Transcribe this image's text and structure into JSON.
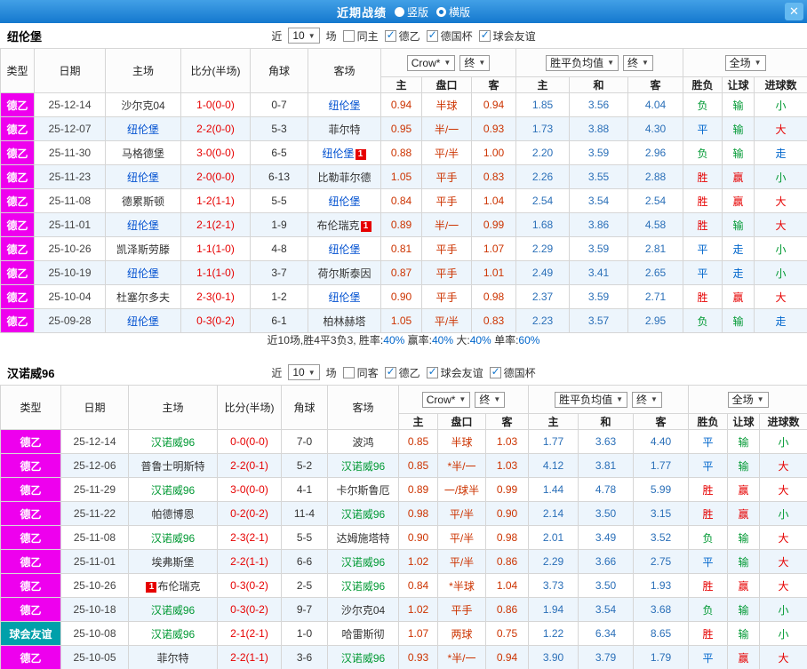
{
  "colors": {
    "topbar_from": "#42a0e6",
    "topbar_to": "#1478ce",
    "league_de2": "#ee00ee",
    "league_friendly": "#00a0aa",
    "score": "#e60000",
    "odds": "#cc3300",
    "avg": "#2a6fb8",
    "win": "#e60000",
    "draw": "#0066cc",
    "lose": "#009933",
    "focus_team_1": "#0050d0",
    "focus_team_2": "#009933",
    "badge": "#e60000",
    "row_alt": "#edf5fc"
  },
  "topbar": {
    "title": "近期战绩",
    "close": "✕",
    "radios": [
      {
        "label": "竖版",
        "checked": false
      },
      {
        "label": "横版",
        "checked": true
      }
    ]
  },
  "result_color_map": {
    "胜": "win",
    "平": "draw",
    "负": "lose",
    "赢": "win",
    "输": "lose",
    "走": "draw",
    "大": "win",
    "小": "lose"
  },
  "sections": [
    {
      "team": "纽伦堡",
      "team_color_key": "focus_team_1",
      "filter": {
        "near": "近",
        "count": "10",
        "unit": "场",
        "checkboxes": [
          {
            "label": "同主",
            "checked": false
          },
          {
            "label": "德乙",
            "checked": true
          },
          {
            "label": "德国杯",
            "checked": true
          },
          {
            "label": "球会友谊",
            "checked": true
          }
        ]
      },
      "columns": {
        "type": "类型",
        "date": "日期",
        "home": "主场",
        "score": "比分(半场)",
        "corner": "角球",
        "away": "客场",
        "odds_source": "Crow*",
        "odds_final": "终",
        "avg_source": "胜平负均值",
        "avg_final": "终",
        "scope": "全场",
        "sub": [
          "主",
          "盘口",
          "客",
          "主",
          "和",
          "客",
          "胜负",
          "让球",
          "进球数"
        ]
      },
      "rows": [
        {
          "league": "德乙",
          "date": "25-12-14",
          "home": "沙尔克04",
          "home_focus": false,
          "away": "纽伦堡",
          "away_focus": true,
          "score": "1-0(0-0)",
          "corner": "0-7",
          "odds": [
            "0.94",
            "半球",
            "0.94"
          ],
          "avg": [
            "1.85",
            "3.56",
            "4.04"
          ],
          "result": "负",
          "handicap": "输",
          "goals": "小"
        },
        {
          "league": "德乙",
          "date": "25-12-07",
          "home": "纽伦堡",
          "home_focus": true,
          "away": "菲尔特",
          "away_focus": false,
          "score": "2-2(0-0)",
          "corner": "5-3",
          "odds": [
            "0.95",
            "半/一",
            "0.93"
          ],
          "avg": [
            "1.73",
            "3.88",
            "4.30"
          ],
          "result": "平",
          "handicap": "输",
          "goals": "大"
        },
        {
          "league": "德乙",
          "date": "25-11-30",
          "home": "马格德堡",
          "home_focus": false,
          "away": "纽伦堡",
          "away_focus": true,
          "away_badge": "1",
          "score": "3-0(0-0)",
          "corner": "6-5",
          "odds": [
            "0.88",
            "平/半",
            "1.00"
          ],
          "avg": [
            "2.20",
            "3.59",
            "2.96"
          ],
          "result": "负",
          "handicap": "输",
          "goals": "走"
        },
        {
          "league": "德乙",
          "date": "25-11-23",
          "home": "纽伦堡",
          "home_focus": true,
          "away": "比勒菲尔德",
          "away_focus": false,
          "score": "2-0(0-0)",
          "corner": "6-13",
          "odds": [
            "1.05",
            "平手",
            "0.83"
          ],
          "avg": [
            "2.26",
            "3.55",
            "2.88"
          ],
          "result": "胜",
          "handicap": "赢",
          "goals": "小"
        },
        {
          "league": "德乙",
          "date": "25-11-08",
          "home": "德累斯顿",
          "home_focus": false,
          "away": "纽伦堡",
          "away_focus": true,
          "score": "1-2(1-1)",
          "corner": "5-5",
          "odds": [
            "0.84",
            "平手",
            "1.04"
          ],
          "avg": [
            "2.54",
            "3.54",
            "2.54"
          ],
          "result": "胜",
          "handicap": "赢",
          "goals": "大"
        },
        {
          "league": "德乙",
          "date": "25-11-01",
          "home": "纽伦堡",
          "home_focus": true,
          "away": "布伦瑞克",
          "away_focus": false,
          "away_badge": "1",
          "score": "2-1(2-1)",
          "corner": "1-9",
          "odds": [
            "0.89",
            "半/一",
            "0.99"
          ],
          "avg": [
            "1.68",
            "3.86",
            "4.58"
          ],
          "result": "胜",
          "handicap": "输",
          "goals": "大"
        },
        {
          "league": "德乙",
          "date": "25-10-26",
          "home": "凯泽斯劳滕",
          "home_focus": false,
          "away": "纽伦堡",
          "away_focus": true,
          "score": "1-1(1-0)",
          "corner": "4-8",
          "odds": [
            "0.81",
            "平手",
            "1.07"
          ],
          "avg": [
            "2.29",
            "3.59",
            "2.81"
          ],
          "result": "平",
          "handicap": "走",
          "goals": "小"
        },
        {
          "league": "德乙",
          "date": "25-10-19",
          "home": "纽伦堡",
          "home_focus": true,
          "away": "荷尔斯泰因",
          "away_focus": false,
          "score": "1-1(1-0)",
          "corner": "3-7",
          "odds": [
            "0.87",
            "平手",
            "1.01"
          ],
          "avg": [
            "2.49",
            "3.41",
            "2.65"
          ],
          "result": "平",
          "handicap": "走",
          "goals": "小"
        },
        {
          "league": "德乙",
          "date": "25-10-04",
          "home": "杜塞尔多夫",
          "home_focus": false,
          "away": "纽伦堡",
          "away_focus": true,
          "score": "2-3(0-1)",
          "corner": "1-2",
          "odds": [
            "0.90",
            "平手",
            "0.98"
          ],
          "avg": [
            "2.37",
            "3.59",
            "2.71"
          ],
          "result": "胜",
          "handicap": "赢",
          "goals": "大"
        },
        {
          "league": "德乙",
          "date": "25-09-28",
          "home": "纽伦堡",
          "home_focus": true,
          "away": "柏林赫塔",
          "away_focus": false,
          "score": "0-3(0-2)",
          "corner": "6-1",
          "odds": [
            "1.05",
            "平/半",
            "0.83"
          ],
          "avg": [
            "2.23",
            "3.57",
            "2.95"
          ],
          "result": "负",
          "handicap": "输",
          "goals": "走"
        }
      ],
      "summary": {
        "prefix": "近10场,胜4平3负3,",
        "stats": [
          {
            "label": "胜率:",
            "value": "40%"
          },
          {
            "label": "赢率:",
            "value": "40%"
          },
          {
            "label": "大:",
            "value": "40%"
          },
          {
            "label": "单率:",
            "value": "60%"
          }
        ]
      }
    },
    {
      "team": "汉诺威96",
      "team_color_key": "focus_team_2",
      "filter": {
        "near": "近",
        "count": "10",
        "unit": "场",
        "checkboxes": [
          {
            "label": "同客",
            "checked": false
          },
          {
            "label": "德乙",
            "checked": true
          },
          {
            "label": "球会友谊",
            "checked": true
          },
          {
            "label": "德国杯",
            "checked": true
          }
        ]
      },
      "columns": {
        "type": "类型",
        "date": "日期",
        "home": "主场",
        "score": "比分(半场)",
        "corner": "角球",
        "away": "客场",
        "odds_source": "Crow*",
        "odds_final": "终",
        "avg_source": "胜平负均值",
        "avg_final": "终",
        "scope": "全场",
        "sub": [
          "主",
          "盘口",
          "客",
          "主",
          "和",
          "客",
          "胜负",
          "让球",
          "进球数"
        ]
      },
      "rows": [
        {
          "league": "德乙",
          "date": "25-12-14",
          "home": "汉诺威96",
          "home_focus": true,
          "away": "波鸿",
          "away_focus": false,
          "score": "0-0(0-0)",
          "corner": "7-0",
          "odds": [
            "0.85",
            "半球",
            "1.03"
          ],
          "avg": [
            "1.77",
            "3.63",
            "4.40"
          ],
          "result": "平",
          "handicap": "输",
          "goals": "小"
        },
        {
          "league": "德乙",
          "date": "25-12-06",
          "home": "普鲁士明斯特",
          "home_focus": false,
          "away": "汉诺威96",
          "away_focus": true,
          "score": "2-2(0-1)",
          "corner": "5-2",
          "odds": [
            "0.85",
            "*半/一",
            "1.03"
          ],
          "avg": [
            "4.12",
            "3.81",
            "1.77"
          ],
          "result": "平",
          "handicap": "输",
          "goals": "大"
        },
        {
          "league": "德乙",
          "date": "25-11-29",
          "home": "汉诺威96",
          "home_focus": true,
          "away": "卡尔斯鲁厄",
          "away_focus": false,
          "score": "3-0(0-0)",
          "corner": "4-1",
          "odds": [
            "0.89",
            "一/球半",
            "0.99"
          ],
          "avg": [
            "1.44",
            "4.78",
            "5.99"
          ],
          "result": "胜",
          "handicap": "赢",
          "goals": "大"
        },
        {
          "league": "德乙",
          "date": "25-11-22",
          "home": "帕德博恩",
          "home_focus": false,
          "away": "汉诺威96",
          "away_focus": true,
          "score": "0-2(0-2)",
          "corner": "11-4",
          "odds": [
            "0.98",
            "平/半",
            "0.90"
          ],
          "avg": [
            "2.14",
            "3.50",
            "3.15"
          ],
          "result": "胜",
          "handicap": "赢",
          "goals": "小"
        },
        {
          "league": "德乙",
          "date": "25-11-08",
          "home": "汉诺威96",
          "home_focus": true,
          "away": "达姆施塔特",
          "away_focus": false,
          "score": "2-3(2-1)",
          "corner": "5-5",
          "odds": [
            "0.90",
            "平/半",
            "0.98"
          ],
          "avg": [
            "2.01",
            "3.49",
            "3.52"
          ],
          "result": "负",
          "handicap": "输",
          "goals": "大"
        },
        {
          "league": "德乙",
          "date": "25-11-01",
          "home": "埃弗斯堡",
          "home_focus": false,
          "away": "汉诺威96",
          "away_focus": true,
          "score": "2-2(1-1)",
          "corner": "6-6",
          "odds": [
            "1.02",
            "平/半",
            "0.86"
          ],
          "avg": [
            "2.29",
            "3.66",
            "2.75"
          ],
          "result": "平",
          "handicap": "输",
          "goals": "大"
        },
        {
          "league": "德乙",
          "date": "25-10-26",
          "home": "布伦瑞克",
          "home_focus": false,
          "home_badge": "1",
          "home_badge_side": "left",
          "away": "汉诺威96",
          "away_focus": true,
          "score": "0-3(0-2)",
          "corner": "2-5",
          "odds": [
            "0.84",
            "*半球",
            "1.04"
          ],
          "avg": [
            "3.73",
            "3.50",
            "1.93"
          ],
          "result": "胜",
          "handicap": "赢",
          "goals": "大"
        },
        {
          "league": "德乙",
          "date": "25-10-18",
          "home": "汉诺威96",
          "home_focus": true,
          "away": "沙尔克04",
          "away_focus": false,
          "score": "0-3(0-2)",
          "corner": "9-7",
          "odds": [
            "1.02",
            "平手",
            "0.86"
          ],
          "avg": [
            "1.94",
            "3.54",
            "3.68"
          ],
          "result": "负",
          "handicap": "输",
          "goals": "小"
        },
        {
          "league": "球会友谊",
          "date": "25-10-08",
          "home": "汉诺威96",
          "home_focus": true,
          "away": "哈雷斯彻",
          "away_focus": false,
          "score": "2-1(2-1)",
          "corner": "1-0",
          "odds": [
            "1.07",
            "两球",
            "0.75"
          ],
          "avg": [
            "1.22",
            "6.34",
            "8.65"
          ],
          "result": "胜",
          "handicap": "输",
          "goals": "小"
        },
        {
          "league": "德乙",
          "date": "25-10-05",
          "home": "菲尔特",
          "home_focus": false,
          "away": "汉诺威96",
          "away_focus": true,
          "score": "2-2(1-1)",
          "corner": "3-6",
          "odds": [
            "0.93",
            "*半/一",
            "0.94"
          ],
          "avg": [
            "3.90",
            "3.79",
            "1.79"
          ],
          "result": "平",
          "handicap": "赢",
          "goals": "大"
        }
      ]
    }
  ]
}
